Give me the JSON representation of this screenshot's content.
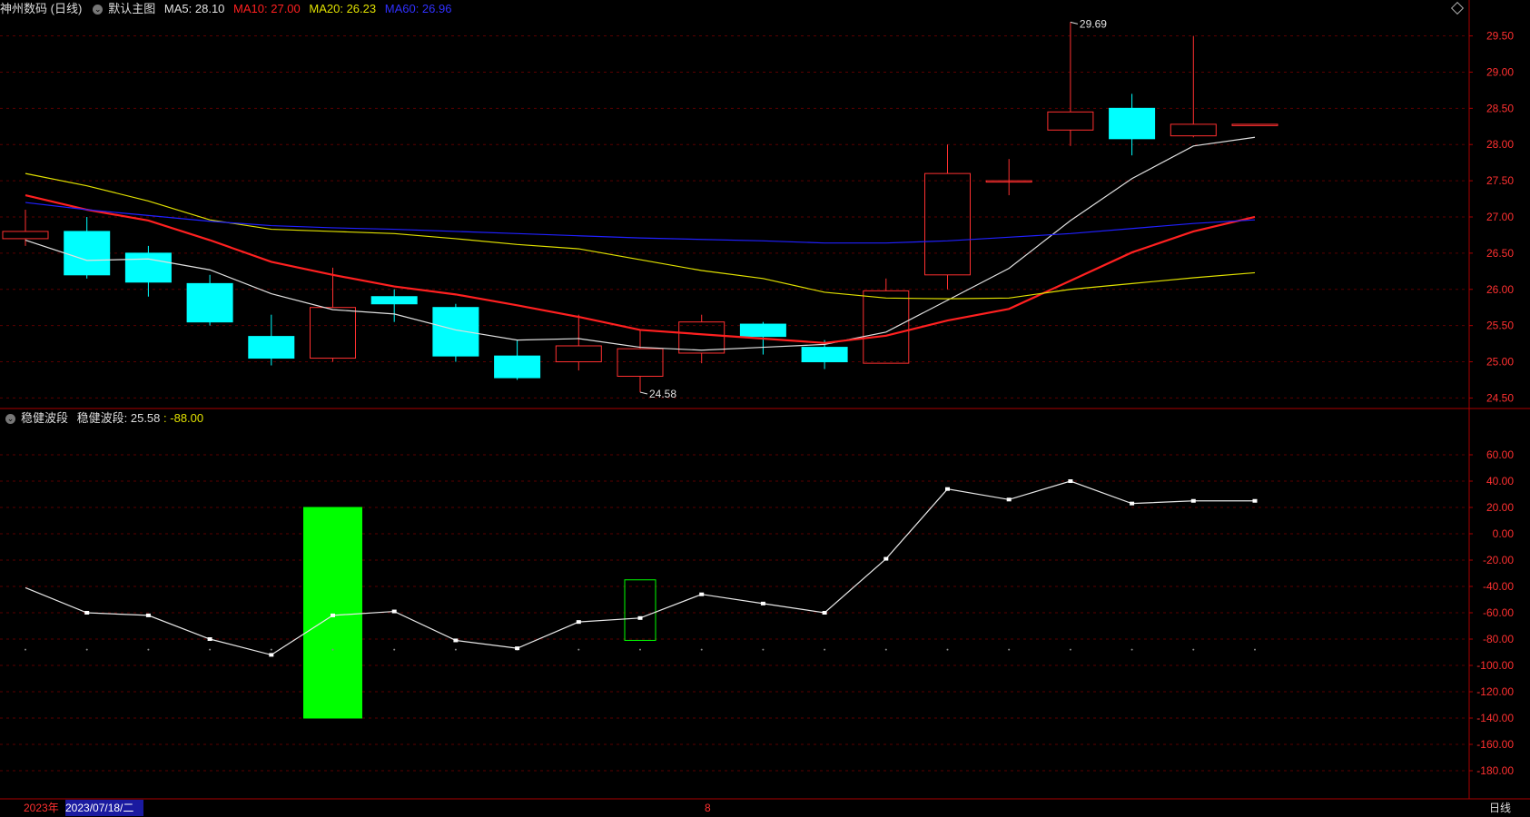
{
  "main_header": {
    "stock": "神州数码 (日线)",
    "template": "默认主图",
    "ma5": "MA5: 28.10",
    "ma10": "MA10: 27.00",
    "ma20": "MA20: 26.23",
    "ma60": "MA60: 26.96"
  },
  "sub_header": {
    "name": "稳健波段",
    "label": "稳健波段: 25.58",
    "value": ": -88.00"
  },
  "footer": {
    "year": "2023年",
    "date": "2023/07/18/二",
    "mid": "8",
    "period": "日线"
  },
  "colors": {
    "up": "#ff3030",
    "down": "#00ffff",
    "ma5": "#e0e0e0",
    "ma10": "#ff2020",
    "ma20": "#e0e000",
    "ma60": "#2020ff",
    "grid": "#5a0000",
    "axis": "#aa0000",
    "green_bar": "#00ff00"
  },
  "chart_data": [
    {
      "type": "candlestick",
      "title": "神州数码 (日线)",
      "ylim": [
        24.38,
        29.72
      ],
      "y_ticks": [
        "29.50",
        "29.00",
        "28.50",
        "28.00",
        "27.50",
        "27.00",
        "26.50",
        "26.00",
        "25.50",
        "25.00",
        "24.50"
      ],
      "candles": [
        {
          "o": 26.7,
          "h": 27.1,
          "l": 26.6,
          "c": 26.8
        },
        {
          "o": 26.8,
          "h": 27.0,
          "l": 26.15,
          "c": 26.2
        },
        {
          "o": 26.5,
          "h": 26.6,
          "l": 25.9,
          "c": 26.1
        },
        {
          "o": 26.08,
          "h": 26.2,
          "l": 25.5,
          "c": 25.55
        },
        {
          "o": 25.35,
          "h": 25.65,
          "l": 24.95,
          "c": 25.05
        },
        {
          "o": 25.05,
          "h": 26.3,
          "l": 25.0,
          "c": 25.75
        },
        {
          "o": 25.9,
          "h": 26.0,
          "l": 25.55,
          "c": 25.8
        },
        {
          "o": 25.75,
          "h": 25.8,
          "l": 25.0,
          "c": 25.08
        },
        {
          "o": 25.08,
          "h": 25.3,
          "l": 24.75,
          "c": 24.78
        },
        {
          "o": 25.0,
          "h": 25.65,
          "l": 24.88,
          "c": 25.22
        },
        {
          "o": 24.8,
          "h": 25.45,
          "l": 24.58,
          "c": 25.18
        },
        {
          "o": 25.12,
          "h": 25.65,
          "l": 24.98,
          "c": 25.55
        },
        {
          "o": 25.52,
          "h": 25.55,
          "l": 25.1,
          "c": 25.35
        },
        {
          "o": 25.2,
          "h": 25.3,
          "l": 24.9,
          "c": 25.0
        },
        {
          "o": 24.98,
          "h": 26.15,
          "l": 24.98,
          "c": 25.98
        },
        {
          "o": 26.2,
          "h": 28.0,
          "l": 26.0,
          "c": 27.6
        },
        {
          "o": 27.5,
          "h": 27.8,
          "l": 27.3,
          "c": 27.5
        },
        {
          "o": 28.2,
          "h": 29.69,
          "l": 27.98,
          "c": 28.45
        },
        {
          "o": 28.5,
          "h": 28.7,
          "l": 27.85,
          "c": 28.08
        },
        {
          "o": 28.12,
          "h": 29.5,
          "l": 28.1,
          "c": 28.28
        },
        {
          "o": 28.28,
          "h": 28.28,
          "l": 28.28,
          "c": 28.28
        }
      ],
      "series": [
        {
          "name": "MA5",
          "values": [
            26.68,
            26.4,
            26.42,
            26.27,
            25.94,
            25.72,
            25.66,
            25.44,
            25.3,
            25.32,
            25.2,
            25.16,
            25.2,
            25.24,
            25.41,
            25.85,
            26.29,
            26.95,
            27.53,
            27.98,
            28.1
          ]
        },
        {
          "name": "MA10",
          "values": [
            27.3,
            27.1,
            26.95,
            26.68,
            26.38,
            26.2,
            26.04,
            25.93,
            25.78,
            25.62,
            25.44,
            25.38,
            25.32,
            25.26,
            25.36,
            25.57,
            25.73,
            26.12,
            26.51,
            26.8,
            27.0
          ]
        },
        {
          "name": "MA20",
          "values": [
            27.6,
            27.43,
            27.22,
            26.96,
            26.83,
            26.8,
            26.77,
            26.7,
            26.62,
            26.56,
            26.41,
            26.26,
            26.15,
            25.96,
            25.88,
            25.87,
            25.88,
            26.0,
            26.08,
            26.16,
            26.23
          ]
        },
        {
          "name": "MA60",
          "values": [
            27.2,
            27.1,
            27.02,
            26.94,
            26.88,
            26.85,
            26.83,
            26.8,
            26.77,
            26.74,
            26.71,
            26.69,
            26.67,
            26.64,
            26.64,
            26.67,
            26.72,
            26.77,
            26.84,
            26.91,
            26.96
          ]
        }
      ],
      "annotations": [
        {
          "index": 17,
          "value": 29.69,
          "text": "29.69"
        },
        {
          "index": 10,
          "value": 24.58,
          "text": "24.58"
        }
      ]
    },
    {
      "type": "line",
      "title": "稳健波段",
      "ylim": [
        -200,
        80
      ],
      "y_ticks": [
        "60.00",
        "40.00",
        "20.00",
        "0.00",
        "-20.00",
        "-40.00",
        "-60.00",
        "-80.00",
        "-100.00",
        "-120.00",
        "-140.00",
        "-160.00",
        "-180.00"
      ],
      "series": [
        {
          "name": "稳健波段",
          "values": [
            -41,
            -60,
            -62,
            -80,
            -92,
            -62,
            -59,
            -81,
            -87,
            -67,
            -64,
            -46,
            -53,
            -60,
            -19,
            34,
            26,
            40,
            23,
            25,
            25
          ]
        }
      ],
      "bars": [
        {
          "index": 5,
          "from": 20,
          "to": -140,
          "style": "filled"
        },
        {
          "index": 10,
          "from": -35,
          "to": -81,
          "style": "outline"
        }
      ],
      "baseline": -88
    }
  ]
}
